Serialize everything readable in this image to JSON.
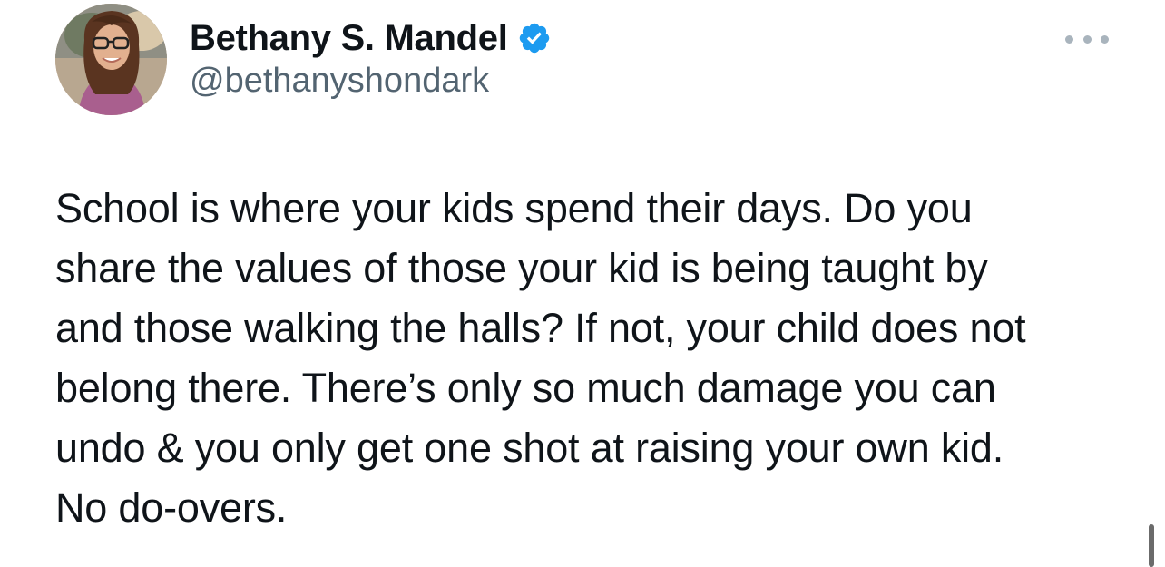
{
  "author": {
    "display_name": "Bethany S. Mandel",
    "handle": "@bethanyshondark",
    "verified_icon": "verified-badge-icon",
    "avatar_icon": "profile-photo"
  },
  "tweet": {
    "text_lines": [
      "School is where your kids spend their days. Do you",
      "share the values of those your kid is being taught by",
      "and those walking the halls? If not, your child does not",
      "belong there. There’s only so much damage you can",
      "undo & you only get one shot at raising your own kid.",
      "No do-overs."
    ]
  },
  "controls": {
    "more_icon": "more-options-icon"
  },
  "colors": {
    "text": "#0f1419",
    "secondary_text": "#536471",
    "verified_blue": "#1d9bf0",
    "background": "#ffffff"
  }
}
